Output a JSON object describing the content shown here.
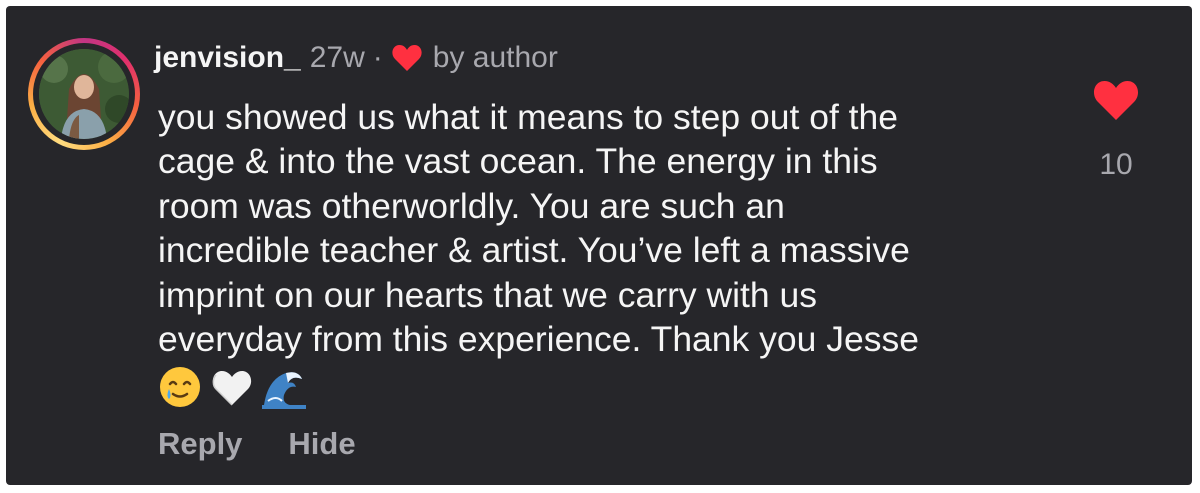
{
  "comment": {
    "username": "jenvision_",
    "age": "27w",
    "separator": "·",
    "liked_by": "by author",
    "text_lines": [
      "you showed us what it means to step out of the",
      "cage & into the vast ocean. The energy in this",
      "room was otherworldly. You are such an",
      "incredible teacher & artist. You’ve left a massive",
      "imprint on our hearts that we carry with us",
      "everyday from this experience. Thank you Jesse"
    ],
    "emojis": [
      "smiling-face-with-tear",
      "white-heart",
      "water-wave"
    ],
    "actions": {
      "reply": "Reply",
      "hide": "Hide"
    },
    "like_count": "10",
    "liked": true
  },
  "icons": {
    "author_like": "heart-icon",
    "like": "heart-icon"
  },
  "colors": {
    "background": "#26262a",
    "heart": "#ff3040",
    "primary_text": "#f5f5f5",
    "secondary_text": "#a8a8ae"
  }
}
